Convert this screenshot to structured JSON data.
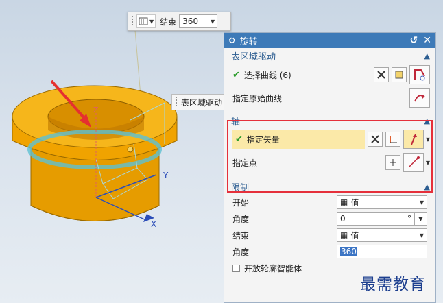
{
  "toolbar": {
    "end_label": "结束",
    "end_value": "360"
  },
  "tip": {
    "label": "表区域驱动"
  },
  "dialog": {
    "title": "旋转",
    "groups": {
      "region": {
        "title": "表区域驱动",
        "select_curve": "选择曲线 (6)",
        "origin_curve": "指定原始曲线"
      },
      "axis": {
        "title": "轴",
        "vector": "指定矢量",
        "point": "指定点"
      },
      "limit": {
        "title": "限制",
        "start_label": "开始",
        "start_value": "值",
        "angle1_label": "角度",
        "angle1_value": "0",
        "angle1_unit": "°",
        "end_label": "结束",
        "end_value": "值",
        "angle2_label": "角度",
        "angle2_value": "360",
        "open_profile": "开放轮廓智能体"
      }
    }
  },
  "scene": {
    "axis_z": "Z",
    "axis_y": "Y",
    "axis_x": "X"
  },
  "watermark": "最需教育",
  "colors": {
    "part": "#f2a900",
    "part_dark": "#c87f00",
    "title_bar": "#3d7ab8",
    "highlight": "#fbe9a8",
    "red_box": "#e5303b"
  }
}
